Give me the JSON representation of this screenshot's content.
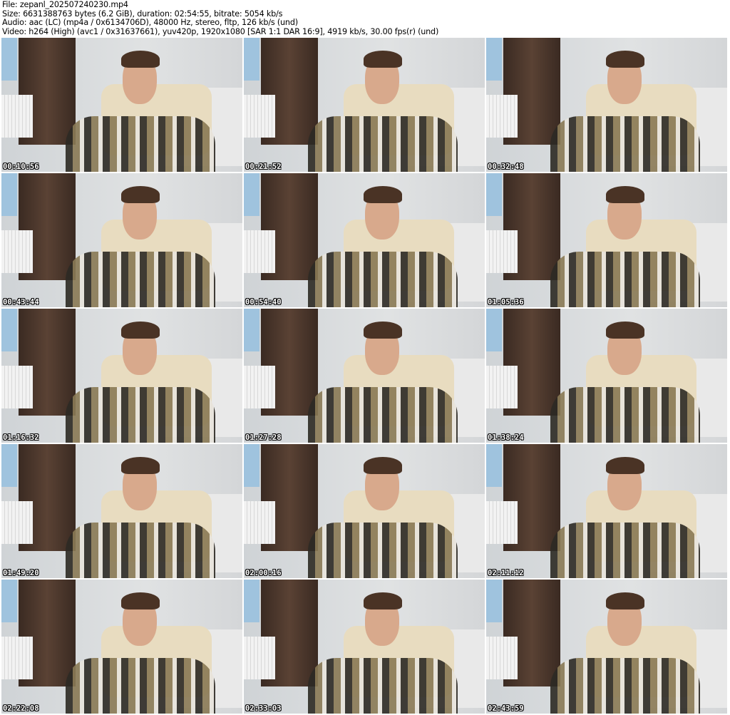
{
  "header": {
    "file": "File: zepanl_202507240230.mp4",
    "size": "Size: 6631388763 bytes (6.2 GiB), duration: 02:54:55, bitrate: 5054 kb/s",
    "audio": "Audio: aac (LC) (mp4a / 0x6134706D), 48000 Hz, stereo, fltp, 126 kb/s (und)",
    "video": "Video: h264 (High) (avc1 / 0x31637661), yuv420p, 1920x1080 [SAR 1:1 DAR 16:9], 4919 kb/s, 30.00 fps(r) (und)"
  },
  "thumbnails": [
    {
      "timestamp": "00:10:56"
    },
    {
      "timestamp": "00:21:52"
    },
    {
      "timestamp": "00:32:48"
    },
    {
      "timestamp": "00:43:44"
    },
    {
      "timestamp": "00:54:40"
    },
    {
      "timestamp": "01:05:36"
    },
    {
      "timestamp": "01:16:32"
    },
    {
      "timestamp": "01:27:28"
    },
    {
      "timestamp": "01:38:24"
    },
    {
      "timestamp": "01:49:20"
    },
    {
      "timestamp": "02:00:16"
    },
    {
      "timestamp": "02:11:12"
    },
    {
      "timestamp": "02:22:08"
    },
    {
      "timestamp": "02:33:03"
    },
    {
      "timestamp": "02:43:59"
    }
  ]
}
